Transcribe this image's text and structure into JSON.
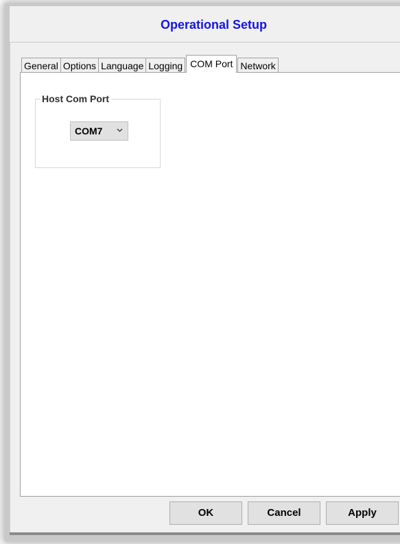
{
  "dialog": {
    "title": "Operational Setup"
  },
  "tabs": [
    {
      "label": "General",
      "active": false
    },
    {
      "label": "Options",
      "active": false
    },
    {
      "label": "Language",
      "active": false
    },
    {
      "label": "Logging",
      "active": false
    },
    {
      "label": "COM Port",
      "active": true
    },
    {
      "label": "Network",
      "active": false
    }
  ],
  "com_port_panel": {
    "group_label": "Host Com Port",
    "port_select": {
      "selected_value": "COM7"
    }
  },
  "buttons": {
    "ok": "OK",
    "cancel": "Cancel",
    "apply": "Apply"
  },
  "colors": {
    "title": "#1414e6",
    "dialog_bg": "#f0f0f0",
    "panel_bg": "#ffffff",
    "button_bg": "#e1e1e1"
  }
}
